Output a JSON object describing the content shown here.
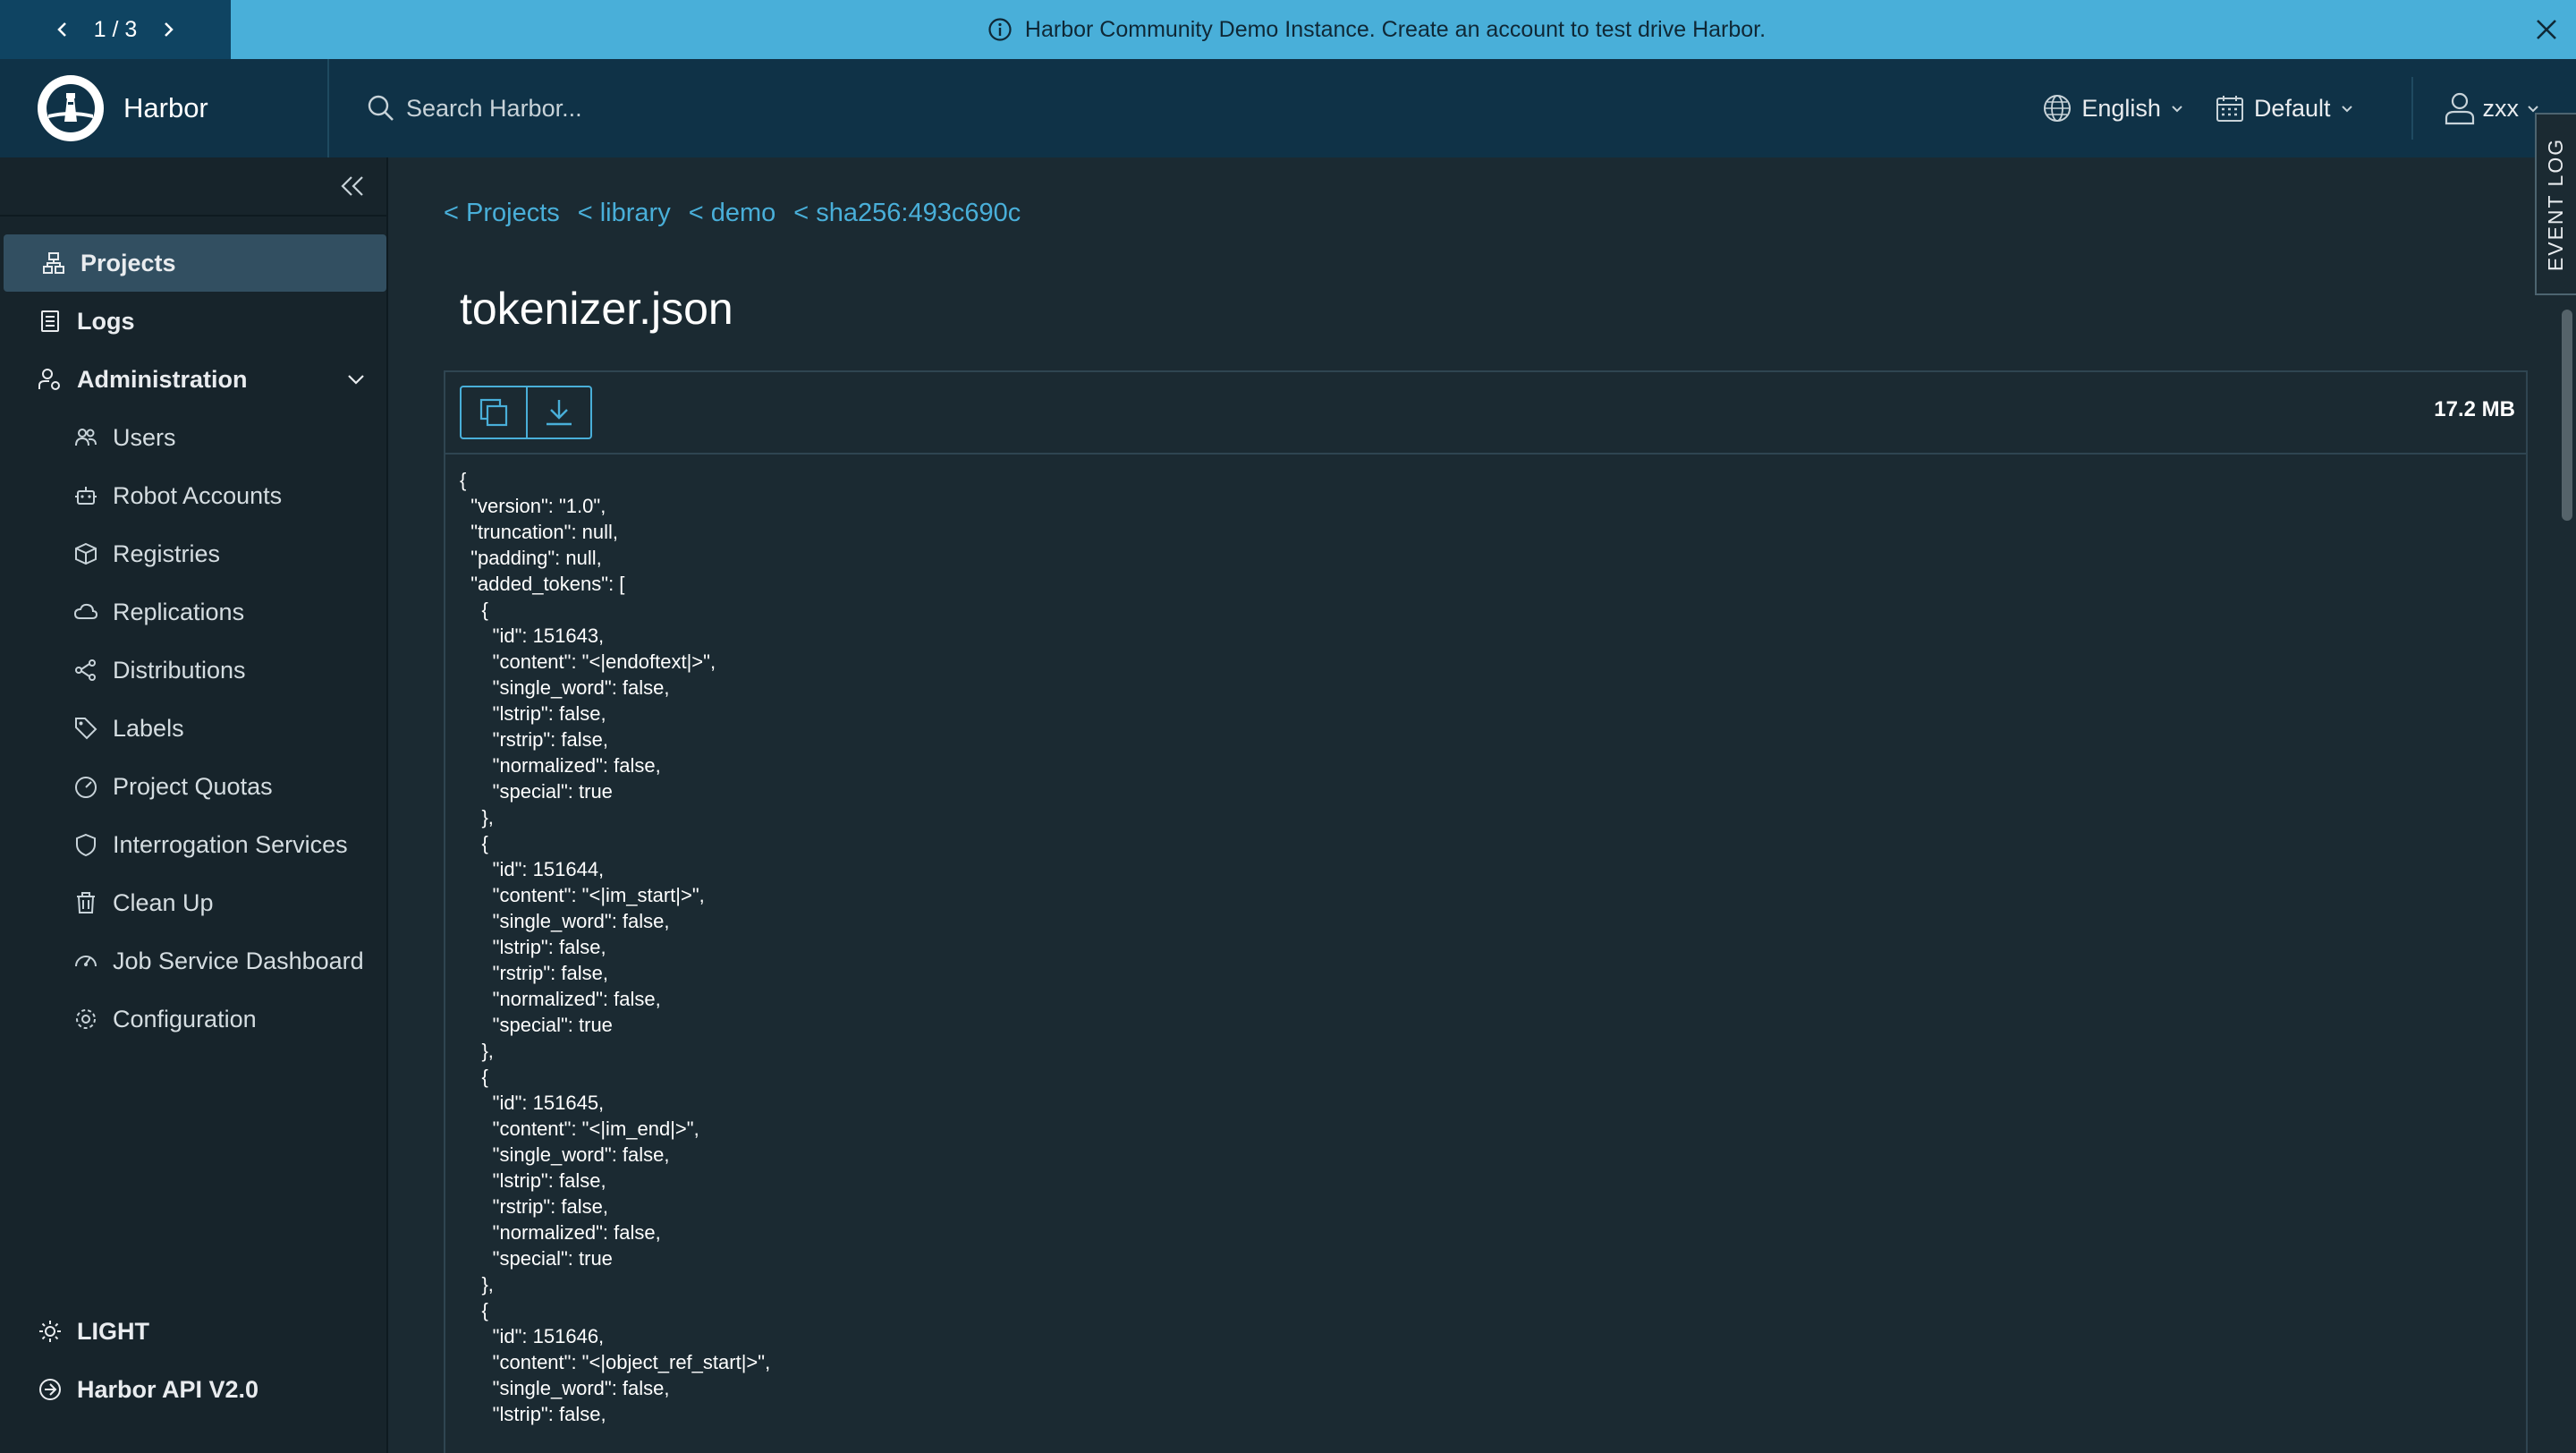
{
  "banner": {
    "pager": "1 / 3",
    "message": "Harbor Community Demo Instance. Create an account to test drive Harbor."
  },
  "header": {
    "brand": "Harbor",
    "search_placeholder": "Search Harbor...",
    "language": "English",
    "theme": "Default",
    "user": "zxx"
  },
  "sidebar": {
    "items": [
      {
        "label": "Projects",
        "icon": "projects-icon"
      },
      {
        "label": "Logs",
        "icon": "logs-icon"
      },
      {
        "label": "Administration",
        "icon": "admin-icon"
      },
      {
        "label": "Users",
        "icon": "users-icon"
      },
      {
        "label": "Robot Accounts",
        "icon": "robot-icon"
      },
      {
        "label": "Registries",
        "icon": "box-icon"
      },
      {
        "label": "Replications",
        "icon": "cloud-icon"
      },
      {
        "label": "Distributions",
        "icon": "share-icon"
      },
      {
        "label": "Labels",
        "icon": "tag-icon"
      },
      {
        "label": "Project Quotas",
        "icon": "gauge-icon"
      },
      {
        "label": "Interrogation Services",
        "icon": "shield-icon"
      },
      {
        "label": "Clean Up",
        "icon": "trash-icon"
      },
      {
        "label": "Job Service Dashboard",
        "icon": "dashboard-icon"
      },
      {
        "label": "Configuration",
        "icon": "gear-icon"
      }
    ],
    "footer": {
      "theme_toggle": "LIGHT",
      "api": "Harbor API V2.0"
    }
  },
  "breadcrumbs": [
    "< Projects",
    "< library",
    "< demo",
    "< sha256:493c690c"
  ],
  "page_title": "tokenizer.json",
  "file": {
    "size": "17.2 MB",
    "lines": [
      "{",
      "  \"version\": \"1.0\",",
      "  \"truncation\": null,",
      "  \"padding\": null,",
      "  \"added_tokens\": [",
      "    {",
      "      \"id\": 151643,",
      "      \"content\": \"<|endoftext|>\",",
      "      \"single_word\": false,",
      "      \"lstrip\": false,",
      "      \"rstrip\": false,",
      "      \"normalized\": false,",
      "      \"special\": true",
      "    },",
      "    {",
      "      \"id\": 151644,",
      "      \"content\": \"<|im_start|>\",",
      "      \"single_word\": false,",
      "      \"lstrip\": false,",
      "      \"rstrip\": false,",
      "      \"normalized\": false,",
      "      \"special\": true",
      "    },",
      "    {",
      "      \"id\": 151645,",
      "      \"content\": \"<|im_end|>\",",
      "      \"single_word\": false,",
      "      \"lstrip\": false,",
      "      \"rstrip\": false,",
      "      \"normalized\": false,",
      "      \"special\": true",
      "    },",
      "    {",
      "      \"id\": 151646,",
      "      \"content\": \"<|object_ref_start|>\",",
      "      \"single_word\": false,",
      "      \"lstrip\": false,"
    ]
  },
  "event_log": "EVENT LOG",
  "colors": {
    "banner": "#49afd9",
    "header": "#0f3247",
    "sidebar": "#17242b",
    "main": "#1b2a32",
    "accent": "#49afd9"
  }
}
